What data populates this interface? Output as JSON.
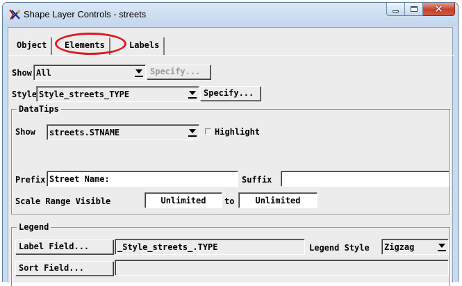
{
  "window": {
    "title": "Shape Layer Controls - streets"
  },
  "tabs": [
    {
      "label": "Object"
    },
    {
      "label": "Elements"
    },
    {
      "label": "Labels"
    }
  ],
  "elements": {
    "show": {
      "label": "Show",
      "value": "All",
      "specify_label": "Specify..."
    },
    "style": {
      "label": "Style",
      "value": "Style_streets_TYPE",
      "specify_label": "Specify..."
    }
  },
  "datatips": {
    "title": "DataTips",
    "show_label": "Show",
    "show_value": "streets.STNAME",
    "highlight_label": "Highlight",
    "prefix_label": "Prefix",
    "prefix_value": "Street Name:",
    "suffix_label": "Suffix",
    "suffix_value": "",
    "scale_label": "Scale Range Visible",
    "scale_min": "Unlimited",
    "to_label": "to",
    "scale_max": "Unlimited"
  },
  "legend": {
    "title": "Legend",
    "label_field_button": "Label Field...",
    "label_field_value": "_Style_streets_.TYPE",
    "legend_style_label": "Legend Style",
    "legend_style_value": "Zigzag",
    "sort_field_button": "Sort Field...",
    "sort_field_value": ""
  },
  "colors": {
    "annotation": "#e3171d",
    "close_button": "#c6402a"
  }
}
